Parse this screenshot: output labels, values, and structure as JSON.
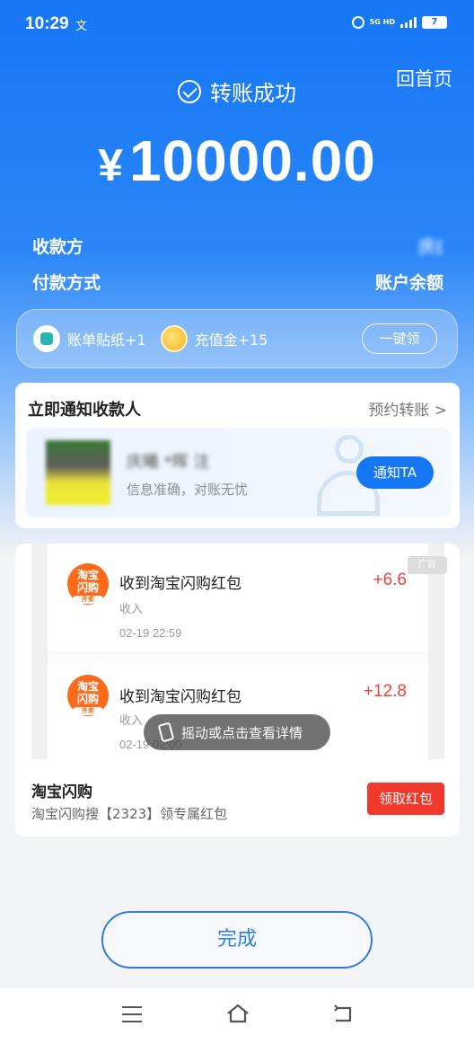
{
  "status_bar": {
    "time": "10:29",
    "extra_icon_text": "文",
    "network": "5G HD",
    "battery": "7"
  },
  "header": {
    "home_link": "回首页",
    "title": "转账成功"
  },
  "amount": {
    "currency": "¥",
    "value": "10000.00"
  },
  "info": {
    "payee_label": "收款方",
    "payee_value": "庆(",
    "payment_method_label": "付款方式",
    "payment_method_value": "账户余额"
  },
  "rewards": {
    "sticker_label": "账单贴纸+1",
    "coin_label": "充值金+15",
    "claim_button": "一键领"
  },
  "notify": {
    "title": "立即通知收款人",
    "schedule_link": "预约转账 >",
    "recipient_name": "庆曦 *晖 注",
    "subtitle": "信息准确，对账无忧",
    "button": "通知TA"
  },
  "ad": {
    "tag": "广告",
    "feed": [
      {
        "title": "收到淘宝闪购红包",
        "type": "收入",
        "time": "02-19 22:59",
        "amount": "+6.6"
      },
      {
        "title": "收到淘宝闪购红包",
        "type": "收入",
        "time": "02-19 02:00",
        "amount": "+12.8"
      }
    ],
    "icon_text_top": "淘宝",
    "icon_text_bottom": "闪购",
    "icon_badge": "外卖",
    "shake_hint": "摇动或点击查看详情",
    "brand": "淘宝闪购",
    "description": "淘宝闪购搜【2323】领专属红包",
    "button": "领取红包"
  },
  "footer": {
    "done_button": "完成"
  }
}
